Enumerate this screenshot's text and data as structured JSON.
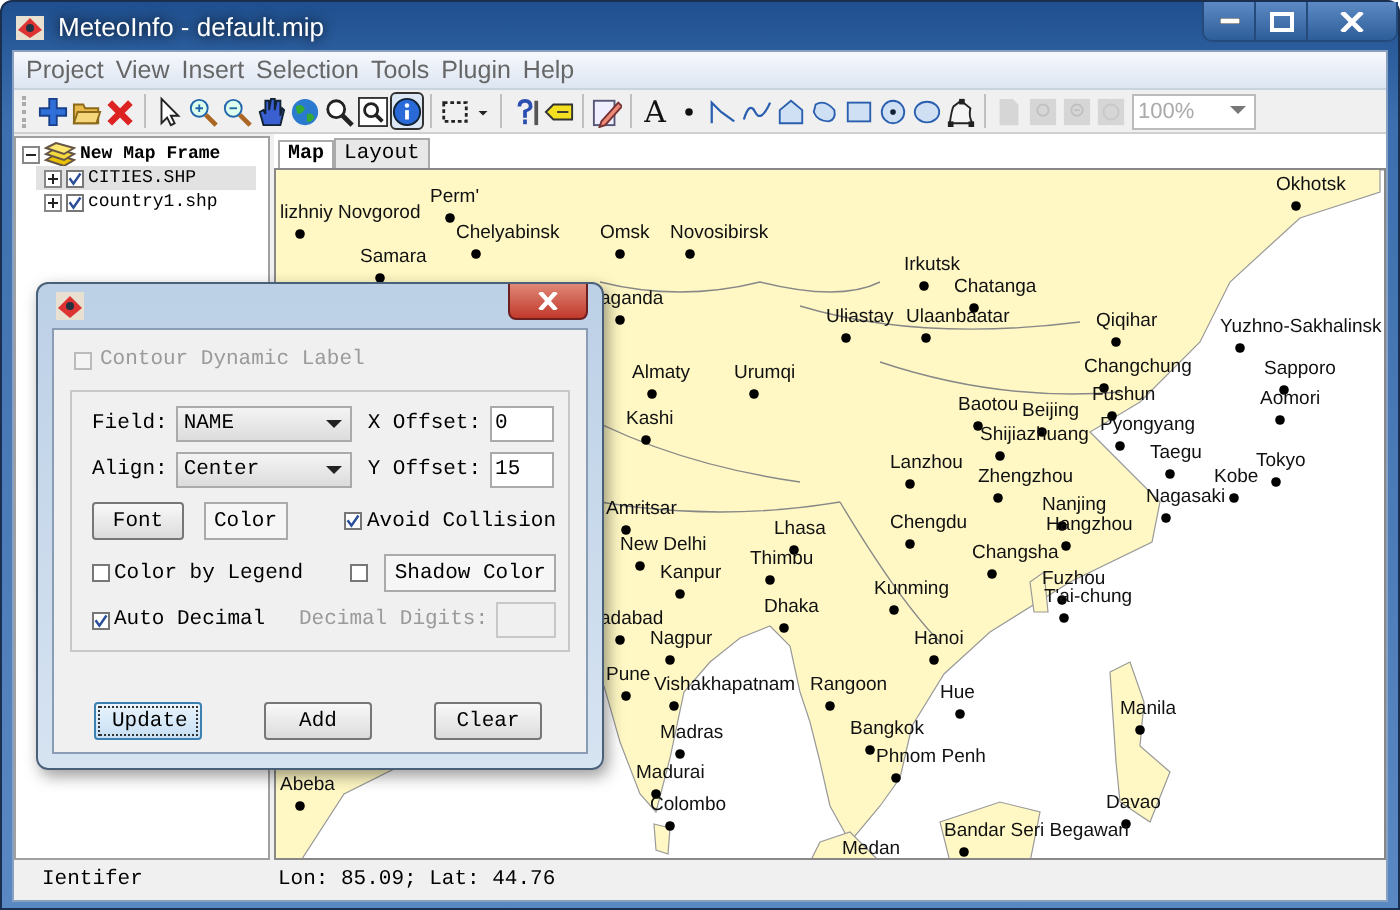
{
  "window": {
    "title": "MeteoInfo - default.mip"
  },
  "menu": [
    "Project",
    "View",
    "Insert",
    "Selection",
    "Tools",
    "Plugin",
    "Help"
  ],
  "toolbar": {
    "tools": [
      {
        "kind": "add",
        "selected": false,
        "disabled": false
      },
      {
        "kind": "open",
        "selected": false,
        "disabled": false
      },
      {
        "kind": "remove",
        "selected": false,
        "disabled": false
      },
      {
        "kind": "separator"
      },
      {
        "kind": "pointer",
        "selected": false,
        "disabled": false
      },
      {
        "kind": "zoom_in",
        "selected": false,
        "disabled": false
      },
      {
        "kind": "zoom_out",
        "selected": false,
        "disabled": false
      },
      {
        "kind": "pan",
        "selected": false,
        "disabled": false
      },
      {
        "kind": "globe",
        "selected": false,
        "disabled": false
      },
      {
        "kind": "magnifier",
        "selected": false,
        "disabled": false
      },
      {
        "kind": "zoom_box",
        "selected": false,
        "disabled": false
      },
      {
        "kind": "identify",
        "selected": true,
        "disabled": false
      },
      {
        "kind": "separator"
      },
      {
        "kind": "select_rect",
        "selected": false,
        "disabled": false
      },
      {
        "kind": "caret",
        "selected": false,
        "disabled": false
      },
      {
        "kind": "separator"
      },
      {
        "kind": "help",
        "selected": false,
        "disabled": false
      },
      {
        "kind": "label",
        "selected": false,
        "disabled": false
      },
      {
        "kind": "separator"
      },
      {
        "kind": "edit",
        "selected": false,
        "disabled": false
      },
      {
        "kind": "separator"
      },
      {
        "kind": "text",
        "glyph": "A",
        "selected": false,
        "disabled": false
      },
      {
        "kind": "point",
        "selected": false,
        "disabled": false
      },
      {
        "kind": "polyline",
        "selected": false,
        "disabled": false
      },
      {
        "kind": "curve",
        "selected": false,
        "disabled": false
      },
      {
        "kind": "polygon",
        "selected": false,
        "disabled": false
      },
      {
        "kind": "rounded",
        "selected": false,
        "disabled": false
      },
      {
        "kind": "rectangle",
        "selected": false,
        "disabled": false
      },
      {
        "kind": "circle",
        "selected": false,
        "disabled": false
      },
      {
        "kind": "ellipse",
        "selected": false,
        "disabled": false
      },
      {
        "kind": "curve_polygon",
        "selected": false,
        "disabled": false
      },
      {
        "kind": "separator"
      },
      {
        "kind": "page",
        "selected": false,
        "disabled": true
      },
      {
        "kind": "page_zoom_in",
        "selected": false,
        "disabled": true
      },
      {
        "kind": "page_zoom_out",
        "selected": false,
        "disabled": true
      },
      {
        "kind": "page_fit",
        "selected": false,
        "disabled": true
      }
    ],
    "zoom": {
      "value": "100%",
      "disabled": true
    }
  },
  "legend": {
    "label": "New Map Frame",
    "expanded": true,
    "layers": [
      {
        "label": "CITIES.SHP",
        "checked": true,
        "selected": true,
        "expanded": false
      },
      {
        "label": "country1.shp",
        "checked": true,
        "selected": false,
        "expanded": false
      }
    ]
  },
  "tabs": [
    {
      "label": "Map",
      "selected": true
    },
    {
      "label": "Layout",
      "selected": false
    }
  ],
  "map": {
    "cities": [
      {
        "name": "Okhotsk"
      },
      {
        "name": "Perm'"
      },
      {
        "name": "lizhniy Novgorod"
      },
      {
        "name": "Chelyabinsk"
      },
      {
        "name": "Samara"
      },
      {
        "name": "Omsk"
      },
      {
        "name": "Novosibirsk"
      },
      {
        "name": "Irkutsk"
      },
      {
        "name": "Chatanga"
      },
      {
        "name": "Uliastay"
      },
      {
        "name": "Ulaanbaatar"
      },
      {
        "name": "Qiqihar"
      },
      {
        "name": "Yuzhno-Sakhalinsk"
      },
      {
        "name": "aganda"
      },
      {
        "name": "Almaty"
      },
      {
        "name": "Urumqi"
      },
      {
        "name": "Changchung"
      },
      {
        "name": "Sapporo"
      },
      {
        "name": "Kashi"
      },
      {
        "name": "Fushun"
      },
      {
        "name": "Baotou"
      },
      {
        "name": "Aomori"
      },
      {
        "name": "Beijing"
      },
      {
        "name": "Pyongyang"
      },
      {
        "name": "Shijiazhuang"
      },
      {
        "name": "Lanzhou"
      },
      {
        "name": "Taegu"
      },
      {
        "name": "Zhengzhou"
      },
      {
        "name": "Kobe"
      },
      {
        "name": "Tokyo"
      },
      {
        "name": "Nagasaki"
      },
      {
        "name": "Amritsar"
      },
      {
        "name": "Nanjing"
      },
      {
        "name": "Lhasa"
      },
      {
        "name": "Chengdu"
      },
      {
        "name": "Hangzhou"
      },
      {
        "name": "New Delhi"
      },
      {
        "name": "Thimbu"
      },
      {
        "name": "Changsha"
      },
      {
        "name": "Kanpur"
      },
      {
        "name": "Kunming"
      },
      {
        "name": "Fuzhou"
      },
      {
        "name": "T'ai-chung"
      },
      {
        "name": "Dhaka"
      },
      {
        "name": "adabad"
      },
      {
        "name": "Nagpur"
      },
      {
        "name": "Hanoi"
      },
      {
        "name": "Rangoon"
      },
      {
        "name": "Pune"
      },
      {
        "name": "Vishakhapatnam"
      },
      {
        "name": "Hue"
      },
      {
        "name": "Manila"
      },
      {
        "name": "Bangkok"
      },
      {
        "name": "Madras"
      },
      {
        "name": "Phnom Penh"
      },
      {
        "name": "Madurai"
      },
      {
        "name": "Abeba"
      },
      {
        "name": "Colombo"
      },
      {
        "name": "Davao"
      },
      {
        "name": "Bandar Seri Begawan"
      },
      {
        "name": "Medan"
      }
    ]
  },
  "status_bar": {
    "left": "Ientifer",
    "coords": "Lon: 85.09; Lat: 44.76"
  },
  "dialog": {
    "contour_dynamic_label": {
      "label": "Contour Dynamic Label",
      "checked": false,
      "disabled": true
    },
    "field": {
      "label": "Field:",
      "value": "NAME"
    },
    "x_offset": {
      "label": "X Offset:",
      "value": "0"
    },
    "align": {
      "label": "Align:",
      "value": "Center"
    },
    "y_offset": {
      "label": "Y Offset:",
      "value": "15"
    },
    "font_button": "Font",
    "color_button": "Color",
    "avoid_collision": {
      "label": "Avoid Collision",
      "checked": true
    },
    "color_by_legend": {
      "label": "Color by Legend",
      "checked": false
    },
    "shadow": {
      "checked": false
    },
    "shadow_color_button": "Shadow Color",
    "auto_decimal": {
      "label": "Auto Decimal",
      "checked": true
    },
    "decimal_digits": {
      "label": "Decimal Digits:",
      "disabled": true
    },
    "buttons": [
      {
        "label": "Update",
        "focused": true
      },
      {
        "label": "Add",
        "focused": false
      },
      {
        "label": "Clear",
        "focused": false
      }
    ]
  }
}
